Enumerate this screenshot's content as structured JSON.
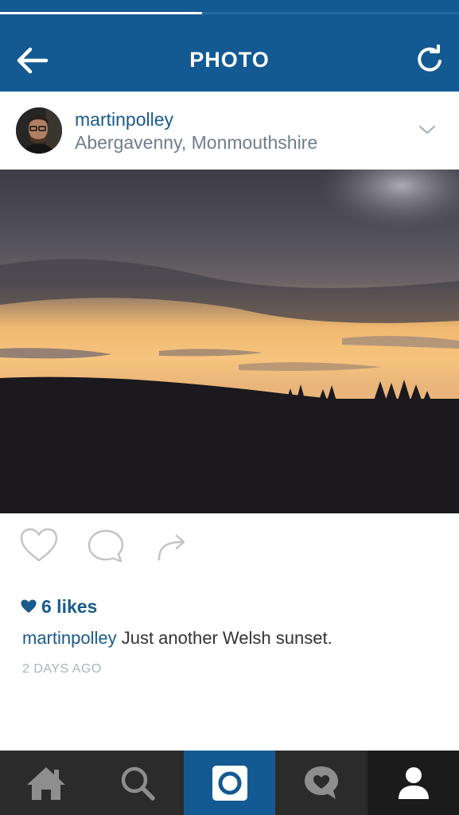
{
  "header": {
    "title": "PHOTO",
    "progress": 0.44
  },
  "post": {
    "username": "martinpolley",
    "location": "Abergavenny, Monmouthshire",
    "likes_text": "6 likes",
    "caption_user": "martinpolley",
    "caption_text": " Just another Welsh sunset.",
    "timestamp": "2 DAYS AGO"
  },
  "icons": {
    "back": "arrow-left-icon",
    "refresh": "refresh-icon",
    "options": "chevron-down-icon",
    "like": "heart-outline-icon",
    "comment": "comment-bubble-icon",
    "share": "share-arrow-icon",
    "likes": "heart-filled-icon"
  },
  "tabbar": {
    "items": [
      "home-icon",
      "search-icon",
      "camera-icon",
      "activity-heart-icon",
      "profile-icon"
    ],
    "active_index": 2,
    "selected_index": 4
  },
  "colors": {
    "header_bg": "#145a92",
    "link_blue": "#1a5a8c",
    "tabbar_bg": "#2b2b2b",
    "camera_tab_bg": "#145a92",
    "selected_tab_bg": "#1b1b1b"
  }
}
